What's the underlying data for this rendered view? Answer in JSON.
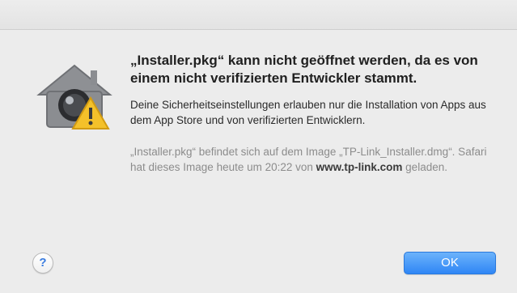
{
  "dialog": {
    "headline": "„Installer.pkg“ kann nicht geöffnet werden, da es von einem nicht verifizierten Entwickler stammt.",
    "body": "Deine Sicherheitseinstellungen erlauben nur die Installation von Apps aus dem App Store und von verifizierten Entwicklern.",
    "info_before": "„Installer.pkg“ befindet sich auf dem Image „TP-Link_Installer.dmg“. Safari hat dieses Image heute um 20:22 von ",
    "info_site": "www.tp-link.com",
    "info_after": " geladen.",
    "icon": "gatekeeper-warning-icon"
  },
  "buttons": {
    "help_label": "?",
    "ok_label": "OK"
  },
  "colors": {
    "accent": "#2f86f5",
    "warning": "#f4c12a"
  }
}
